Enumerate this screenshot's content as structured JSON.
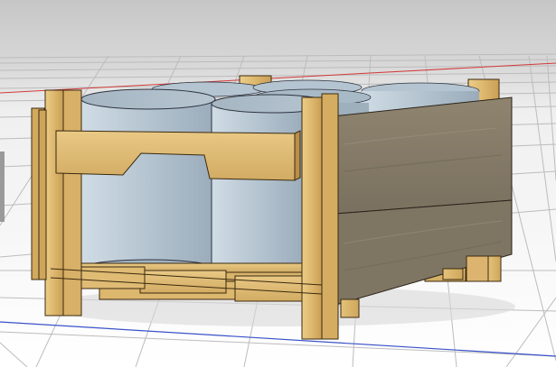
{
  "viewport": {
    "role": "3d-cad-viewport",
    "colors": {
      "background_top": "#c8c8c8",
      "background_bottom": "#ffffff",
      "grid_line": "#b9b9b9",
      "axis_x": "#d23a3a",
      "axis_y": "#3a52c8",
      "timber_light": "#e4c37c",
      "timber_mid": "#d6ae63",
      "timber_dark": "#b58a45",
      "board_grey": "#877d6c",
      "board_grey_dark": "#6f6656",
      "drum_light": "#c5d3dd",
      "drum_mid": "#a9bac7",
      "drum_dark": "#8b9cab"
    },
    "scene": {
      "object": "wooden-crate-with-cylindrical-drums",
      "drum_count": 6,
      "visible_text": []
    }
  }
}
